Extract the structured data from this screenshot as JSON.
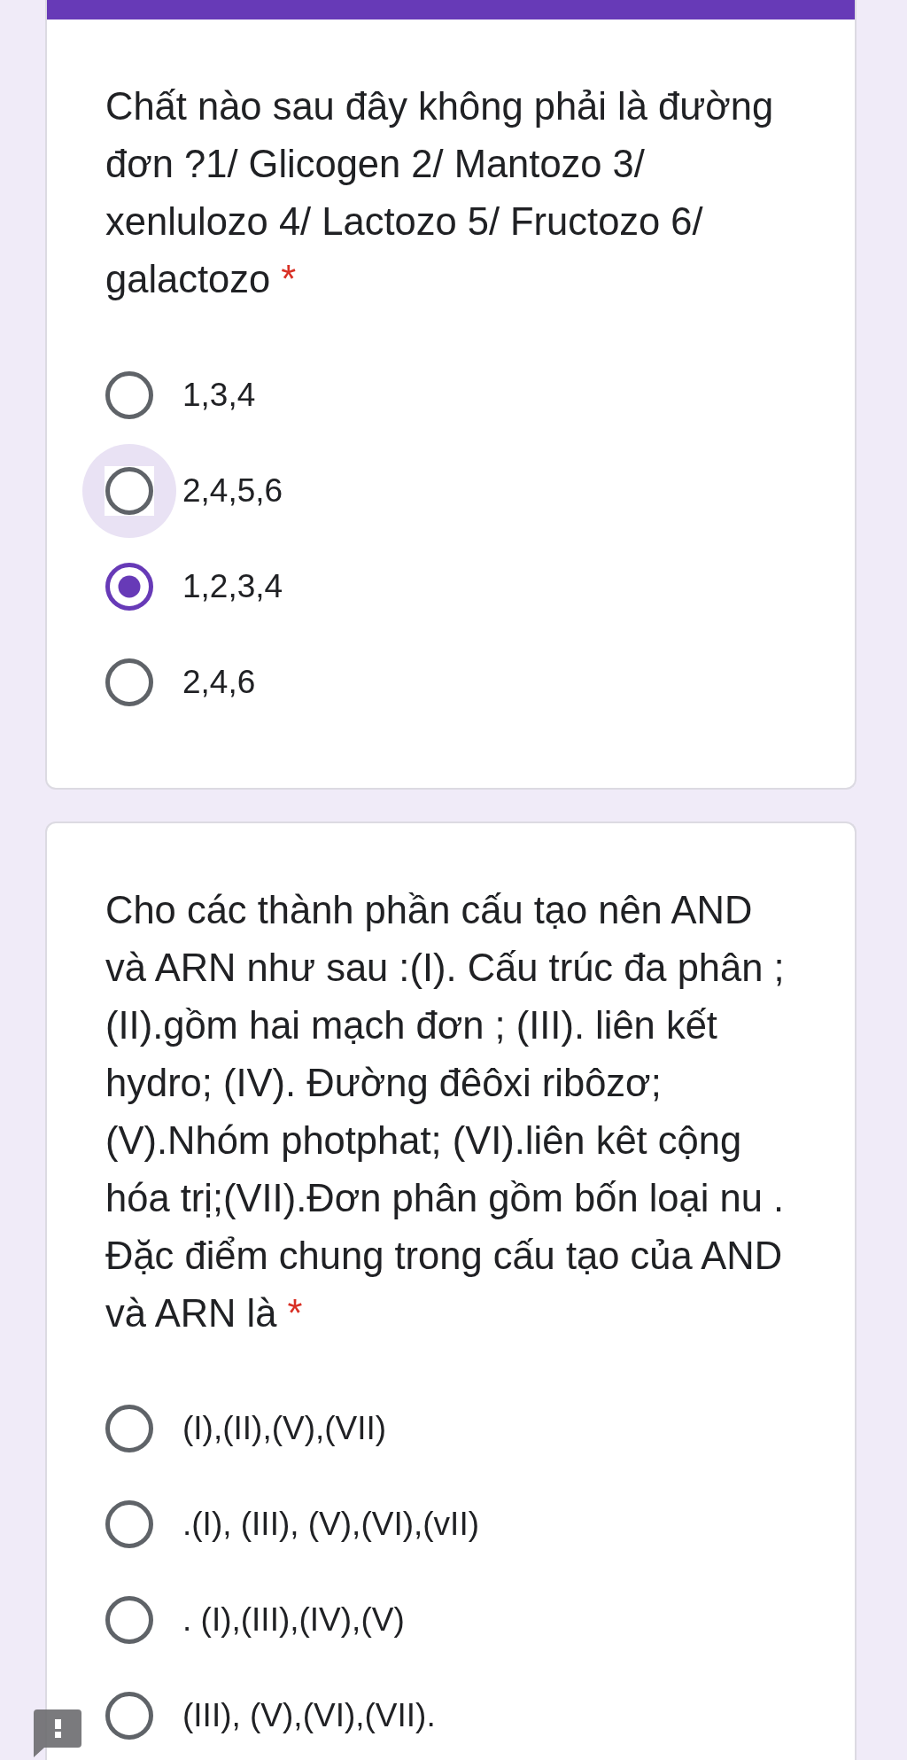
{
  "questions": [
    {
      "accent_bar": true,
      "title": "Chất nào sau đây không phải là đường đơn ?1/ Glicogen 2/ Mantozo 3/ xenlulozo 4/ Lactozo 5/ Fructozo 6/ galactozo",
      "required_mark": "*",
      "options": [
        {
          "label": "1,3,4",
          "selected": false,
          "focused": false
        },
        {
          "label": "2,4,5,6",
          "selected": false,
          "focused": true
        },
        {
          "label": "1,2,3,4",
          "selected": true,
          "focused": false
        },
        {
          "label": "2,4,6",
          "selected": false,
          "focused": false
        }
      ]
    },
    {
      "accent_bar": false,
      "title": "Cho các thành phần cấu tạo nên AND và ARN như sau :(I). Cấu trúc đa phân ; (II).gồm hai mạch đơn ; (III). liên kết hydro; (IV). Đường đêôxi ribôzơ; (V).Nhóm photphat; (VI).liên kêt cộng hóa trị;(VII).Đơn phân gồm bốn loại nu . Đặc điểm chung trong cấu tạo của AND và ARN là",
      "required_mark": "*",
      "options": [
        {
          "label": "(I),(II),(V),(VII)",
          "selected": false,
          "focused": false
        },
        {
          "label": ".(I), (III), (V),(VI),(vII)",
          "selected": false,
          "focused": false
        },
        {
          "label": ". (I),(III),(IV),(V)",
          "selected": false,
          "focused": false
        },
        {
          "label": "(III), (V),(VI),(VII).",
          "selected": false,
          "focused": false
        }
      ]
    }
  ]
}
